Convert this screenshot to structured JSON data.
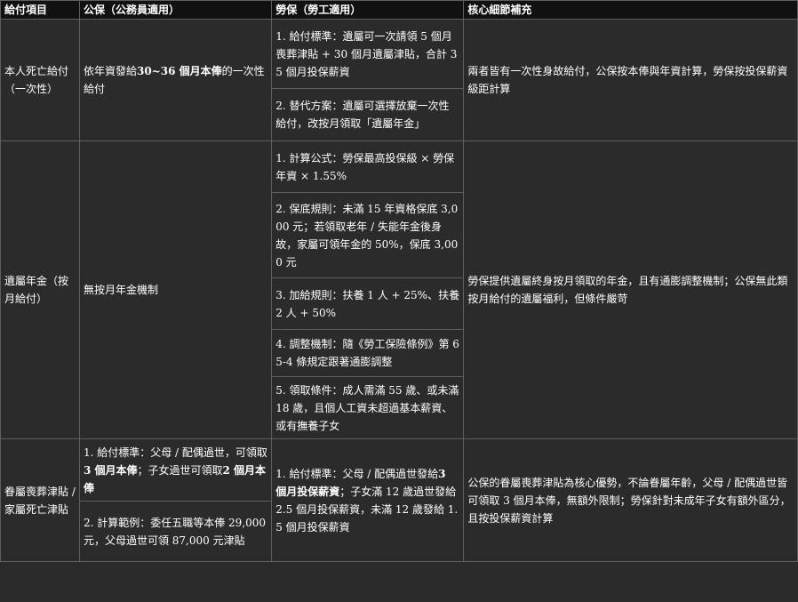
{
  "headers": [
    "給付項目",
    "公保（公務員適用）",
    "勞保（勞工適用）",
    "核心細節補充"
  ],
  "rows": {
    "death": {
      "item": "本人死亡給付（一次性）",
      "gov_pre": "依年資發給",
      "gov_bold": "30~36 個月本俸",
      "gov_post": "的一次性給付",
      "labor": [
        "1. 給付標準：遺屬可一次請領 5 個月喪葬津貼 + 30 個月遺屬津貼，合計 35 個月投保薪資",
        "2. 替代方案：遺屬可選擇放棄一次性給付，改按月領取「遺屬年金」"
      ],
      "note": "兩者皆有一次性身故給付，公保按本俸與年資計算，勞保按投保薪資級距計算"
    },
    "pension": {
      "item": "遺屬年金（按月給付）",
      "gov": "無按月年金機制",
      "labor": [
        "1. 計算公式：勞保最高投保級 × 勞保年資 × 1.55%",
        "2. 保底規則：未滿 15 年資格保底 3,000 元；若領取老年 / 失能年金後身故，家屬可領年金的 50%，保底 3,000 元",
        "3. 加給規則：扶養 1 人 + 25%、扶養 2 人 + 50%",
        "4. 調整機制：隨《勞工保險條例》第 65-4 條規定跟著通膨調整",
        "5. 領取條件：成人需滿 55 歲、或未滿 18 歲，且個人工資未超過基本薪資、或有撫養子女"
      ],
      "note": "勞保提供遺屬終身按月領取的年金，且有通膨調整機制；公保無此類按月給付的遺屬福利，但條件嚴苛"
    },
    "funeral": {
      "item": "眷屬喪葬津貼 / 家屬死亡津貼",
      "gov1_a": "1. 給付標準：父母 / 配偶過世，可領取",
      "gov1_b": "3 個月本俸",
      "gov1_c": "；子女過世可領取",
      "gov1_d": "2 個月本俸",
      "gov2": "2. 計算範例：委任五職等本俸 29,000 元，父母過世可領 87,000 元津貼",
      "labor_a": "1. 給付標準：父母 / 配偶過世發給",
      "labor_b": "3 個月投保薪資",
      "labor_c": "；子女滿 12 歲過世發給 2.5 個月投保薪資，未滿 12 歲發給 1.5 個月投保薪資",
      "note": "公保的眷屬喪葬津貼為核心優勢，不論眷屬年齡，父母 / 配偶過世皆可領取 3 個月本俸，無額外限制；勞保針對未成年子女有額外區分，且按投保薪資計算"
    }
  }
}
